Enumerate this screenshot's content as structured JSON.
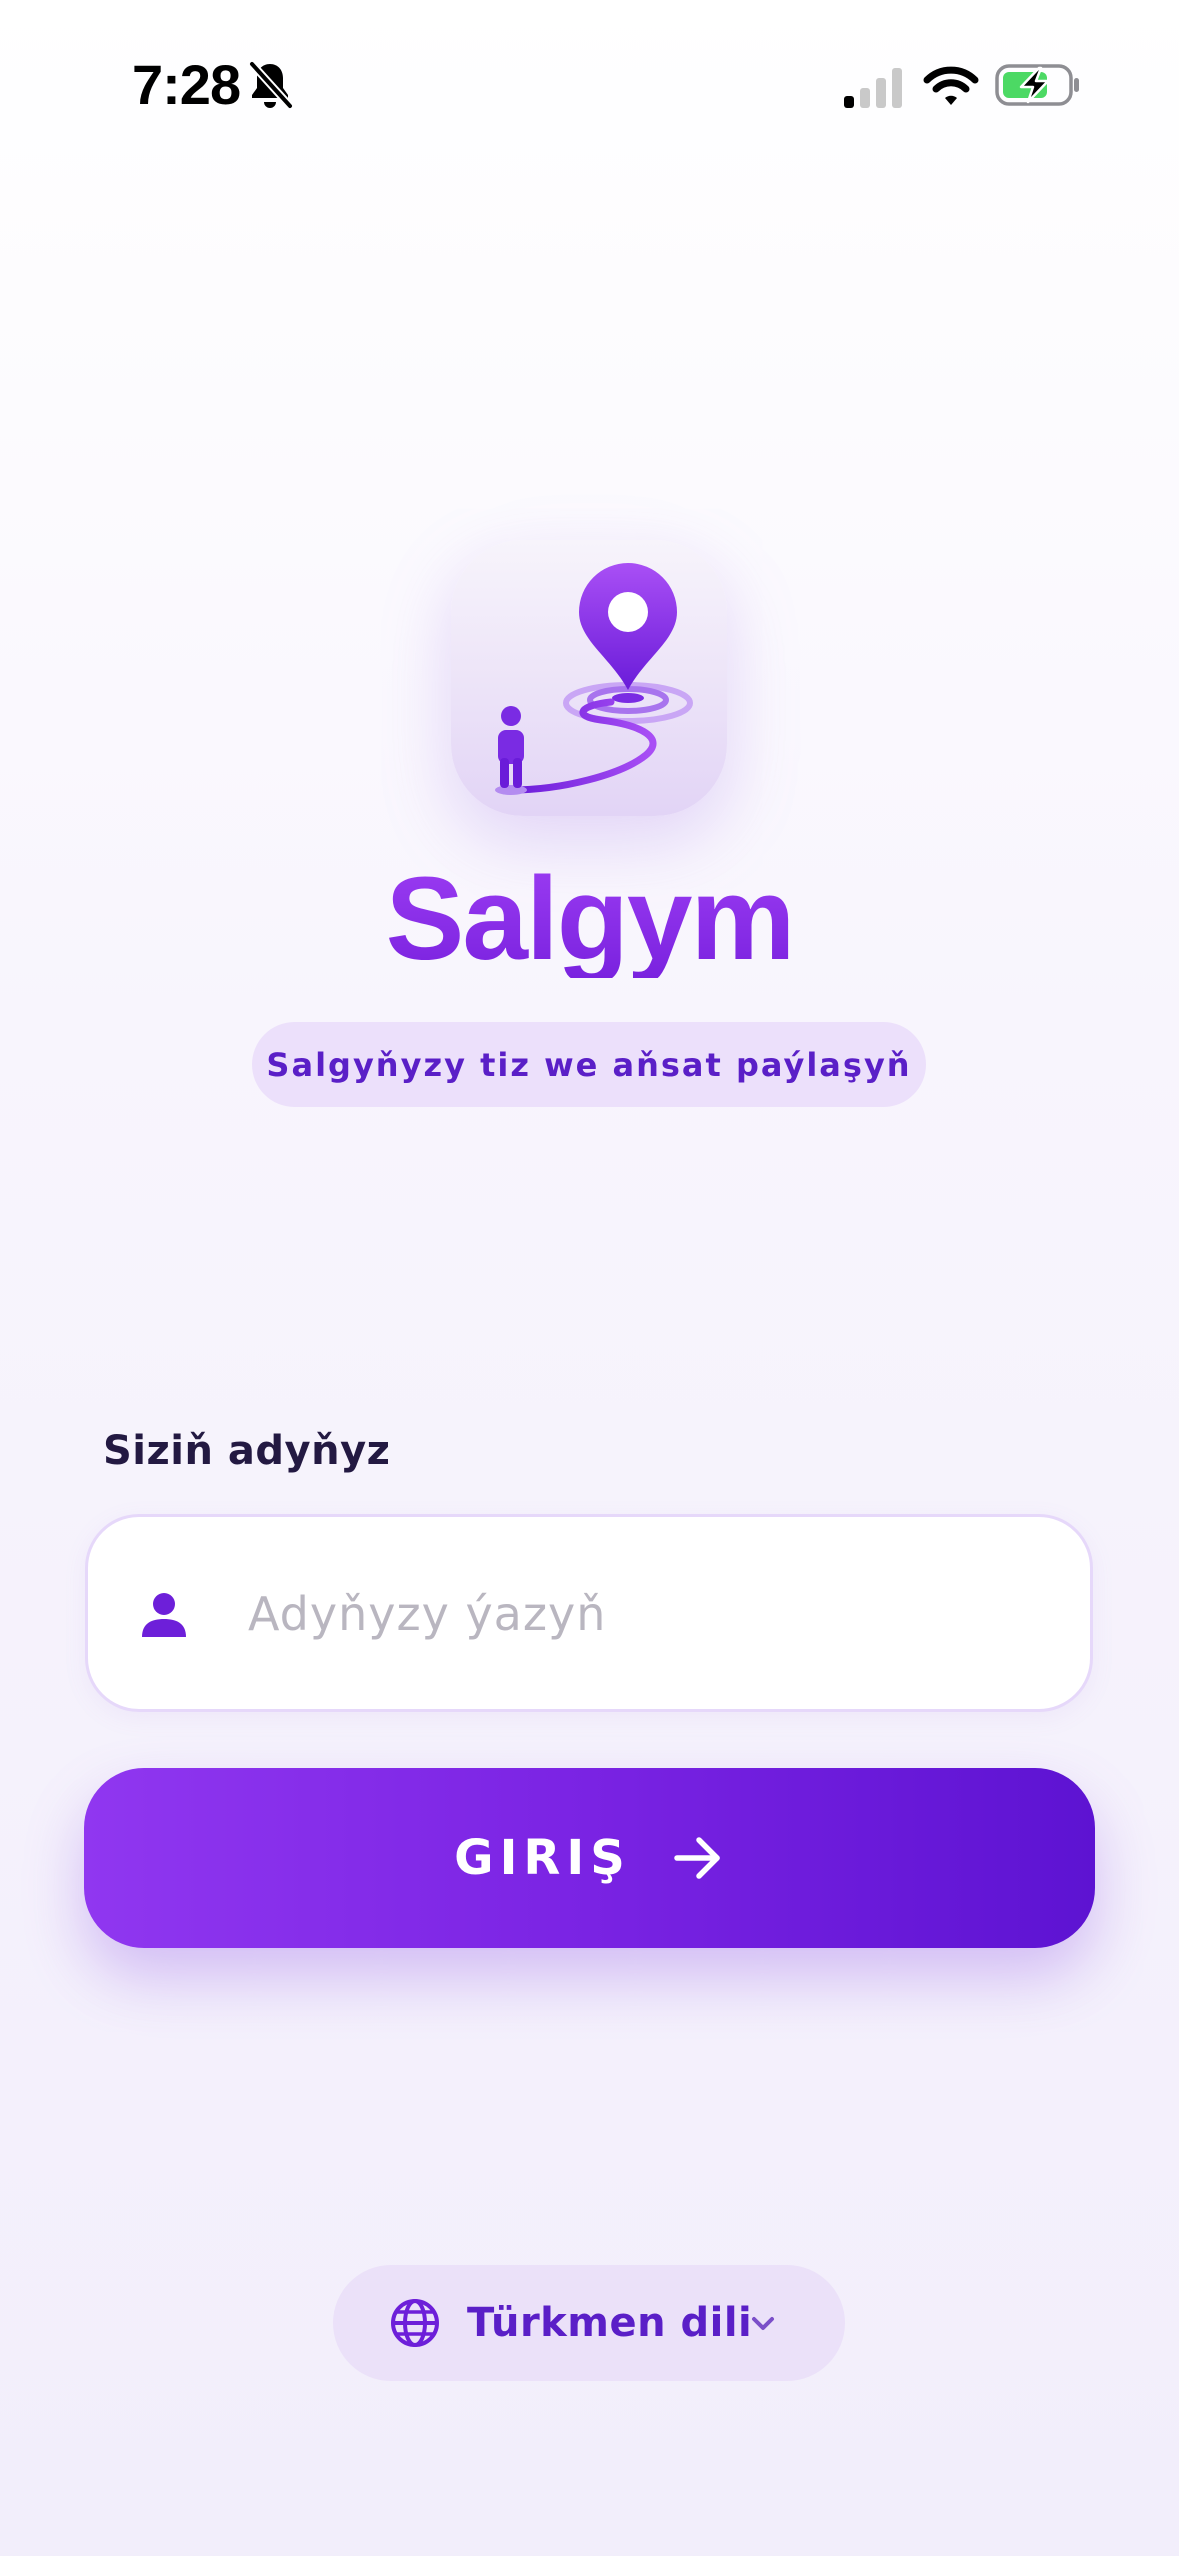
{
  "status_bar": {
    "time": "7:28",
    "icons": [
      "bell-slash-icon",
      "cellular-signal-icon",
      "wifi-icon",
      "battery-charging-icon"
    ]
  },
  "header": {
    "logo_icon": "location-pin-path-icon",
    "title": "Salgym",
    "tagline": "Salgyňyzy tiz we aňsat paýlaşyň"
  },
  "form": {
    "name_label": "Siziň adyňyz",
    "name_placeholder": "Adyňyzy ýazyň",
    "name_value": "",
    "user_icon": "user-icon",
    "login_label": "GIRIŞ",
    "login_icon": "arrow-right-icon"
  },
  "language": {
    "icon": "globe-icon",
    "selected": "Türkmen dili",
    "dropdown_icon": "chevron-down-icon"
  },
  "colors": {
    "primary": "#7a23e3",
    "primary_light": "#9037f0",
    "primary_dark": "#5d13d2",
    "pill_background": "#ece0fb",
    "text_dark": "#231942",
    "placeholder": "#b9b6c0"
  }
}
